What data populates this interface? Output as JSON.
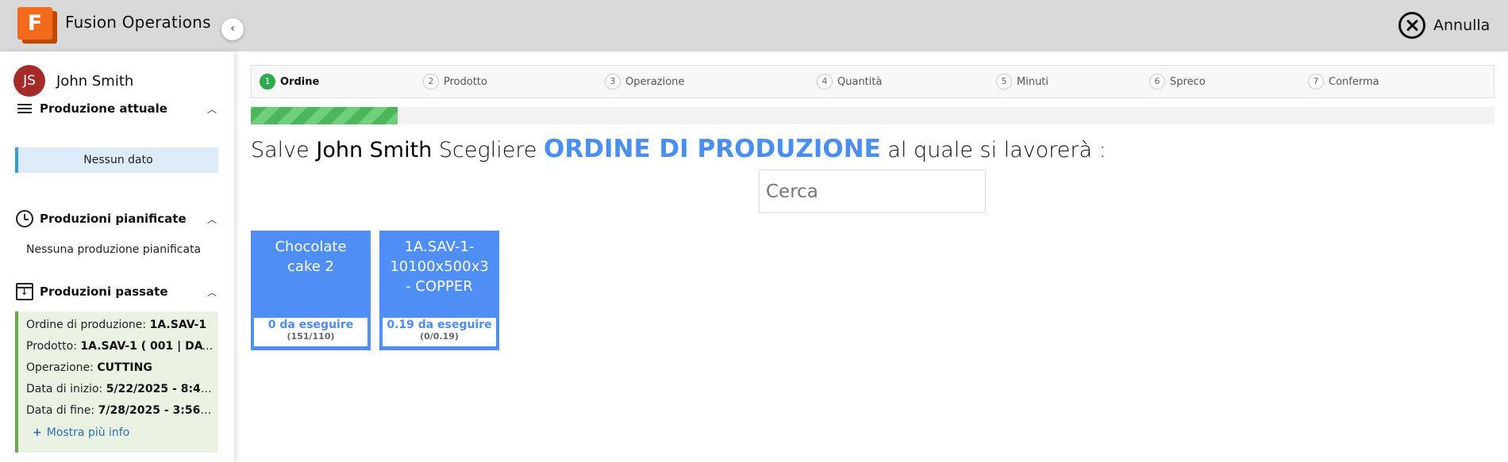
{
  "app": {
    "title": "Fusion Operations",
    "logo_letter": "F",
    "brand_color": "#f26b1d"
  },
  "header": {
    "cancel_label": "Annulla"
  },
  "user": {
    "initials": "JS",
    "name": "John Smith",
    "avatar_color": "#a52a2a"
  },
  "sidebar": {
    "current": {
      "title": "Produzione attuale",
      "empty": "Nessun dato"
    },
    "planned": {
      "title": "Produzioni pianificate",
      "empty": "Nessuna produzione pianificata"
    },
    "past": {
      "title": "Produzioni passate",
      "rows": [
        {
          "label": "Ordine di produzione:",
          "value": "1A.SAV-1"
        },
        {
          "label": "Prodotto:",
          "value": "1A.SAV-1 ( 001 | DAY ..."
        },
        {
          "label": "Operazione:",
          "value": "CUTTING"
        },
        {
          "label": "Data di inizio:",
          "value": "5/22/2025 - 8:46..."
        },
        {
          "label": "Data di fine:",
          "value": "7/28/2025 - 3:56 P..."
        }
      ],
      "more_label": "Mostra più info"
    }
  },
  "stepper": {
    "steps": [
      {
        "num": "1",
        "label": "Ordine"
      },
      {
        "num": "2",
        "label": "Prodotto"
      },
      {
        "num": "3",
        "label": "Operazione"
      },
      {
        "num": "4",
        "label": "Quantità"
      },
      {
        "num": "5",
        "label": "Minuti"
      },
      {
        "num": "6",
        "label": "Spreco"
      },
      {
        "num": "7",
        "label": "Conferma"
      }
    ],
    "active_index": 0,
    "progress_fraction": 0.118
  },
  "prompt": {
    "greeting": "Salve",
    "name": "John Smith",
    "before": "Scegliere",
    "highlight": "ORDINE DI PRODUZIONE",
    "after": "al quale si lavorerà :"
  },
  "search": {
    "placeholder": "Cerca",
    "value": ""
  },
  "orders": [
    {
      "name": "Chocolate cake 2",
      "todo": "0 da eseguire",
      "counts": "(151/110)"
    },
    {
      "name": "1A.SAV-1-10100x500x3 - COPPER",
      "todo": "0.19 da eseguire",
      "counts": "(0/0.19)"
    }
  ],
  "colors": {
    "accent": "#4a8ef0",
    "card": "#4f8ff5",
    "active_step": "#2eaa4a",
    "past_border": "#6aa84f",
    "current_border": "#3a9ad9"
  }
}
